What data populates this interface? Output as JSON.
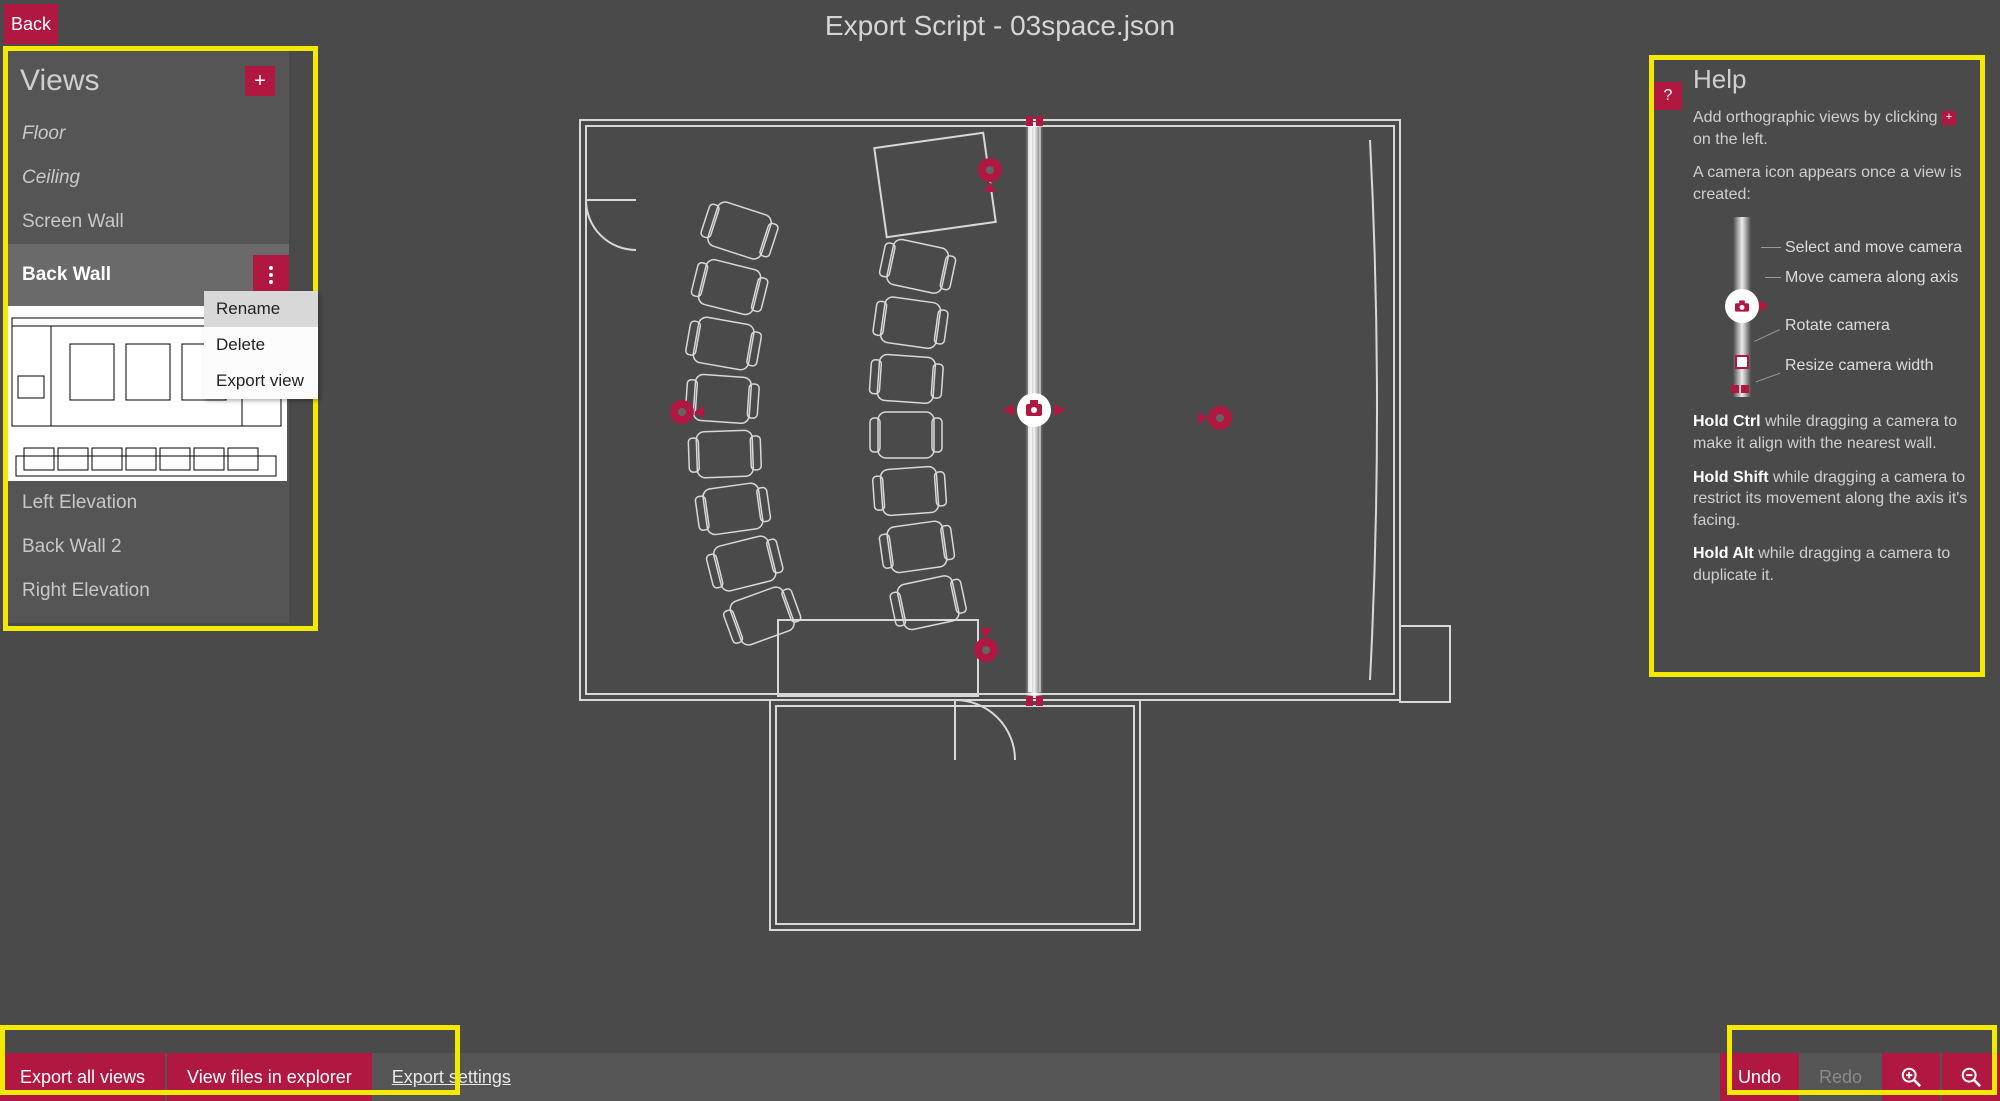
{
  "header": {
    "back_label": "Back",
    "title": "Export Script - 03space.json"
  },
  "views_panel": {
    "title": "Views",
    "add_icon": "+",
    "items": [
      "Floor",
      "Ceiling",
      "Screen Wall",
      "Back Wall",
      "Left Elevation",
      "Back Wall 2",
      "Right Elevation"
    ],
    "selected_index": 3,
    "context_menu": {
      "items": [
        "Rename",
        "Delete",
        "Export view"
      ],
      "highlighted_index": 0
    }
  },
  "help_panel": {
    "title": "Help",
    "toggle": "?",
    "p1_a": "Add orthographic views by clicking ",
    "p1_b": " on the left.",
    "p2": "A camera icon appears once a view is created:",
    "labels": {
      "select": "Select and move camera",
      "axis": "Move camera along axis",
      "rotate": "Rotate camera",
      "resize": "Resize camera width"
    },
    "tip_ctrl_b": "Hold Ctrl",
    "tip_ctrl": " while dragging a camera to make it align with the nearest wall.",
    "tip_shift_b": "Hold Shift",
    "tip_shift": " while dragging a camera to restrict its movement along the axis it's facing.",
    "tip_alt_b": "Hold Alt",
    "tip_alt": " while dragging a camera to duplicate it."
  },
  "bottom_bar": {
    "export_all": "Export all views",
    "view_files": "View files in explorer",
    "export_settings": "Export settings",
    "undo": "Undo",
    "redo": "Redo"
  }
}
